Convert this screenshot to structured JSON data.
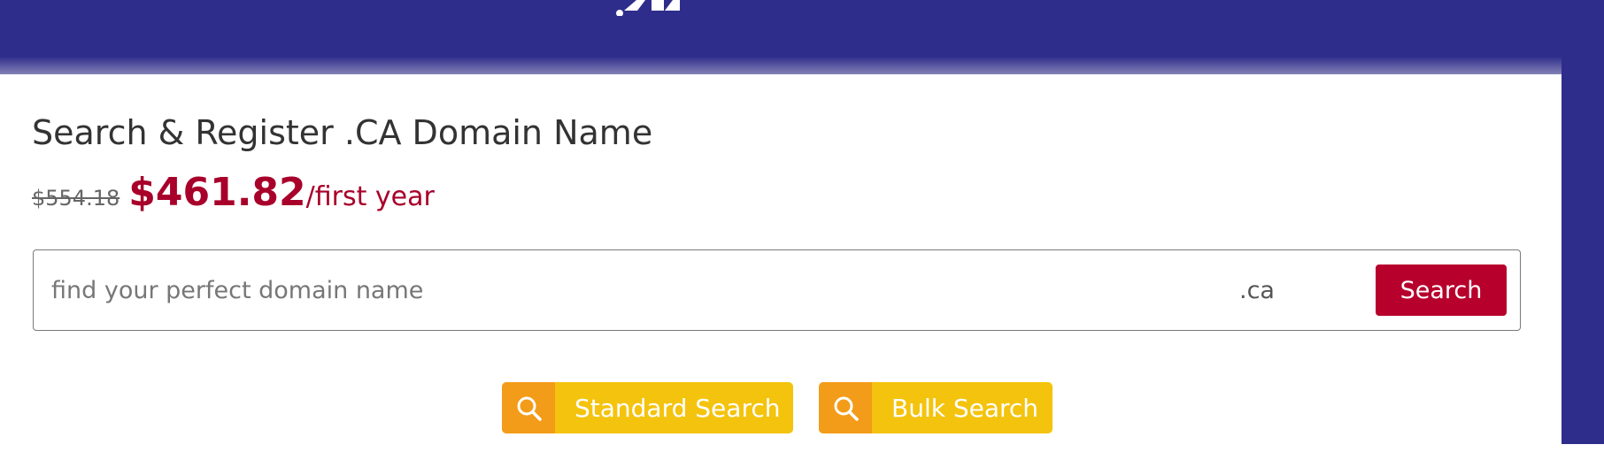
{
  "page": {
    "title": "Search & Register .CA Domain Name"
  },
  "pricing": {
    "old_price": "$554.18",
    "new_price": "$461.82",
    "suffix": "/first year"
  },
  "search": {
    "placeholder": "find your perfect domain name",
    "value": "",
    "tld": ".ca",
    "button_label": "Search"
  },
  "search_modes": [
    {
      "label": "Standard Search",
      "icon": "search-icon"
    },
    {
      "label": "Bulk Search",
      "icon": "search-icon"
    }
  ],
  "colors": {
    "header_background": "#2f2d8c",
    "price": "#a8002a",
    "search_button": "#b7002c",
    "mode_button": "#f4c30d",
    "mode_icon_background": "#f39c19"
  }
}
